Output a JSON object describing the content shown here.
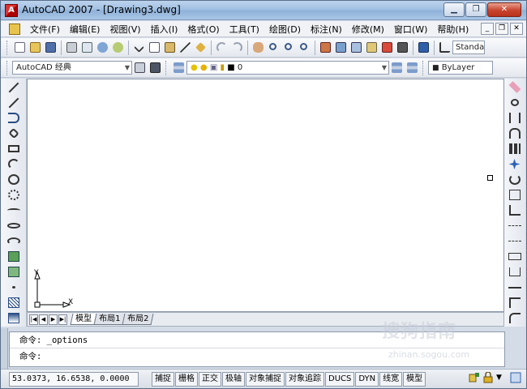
{
  "window": {
    "title": "AutoCAD 2007 - [Drawing3.dwg]",
    "buttons": {
      "minimize": "▁",
      "restore": "❐",
      "close": "✕"
    }
  },
  "menu": {
    "items": [
      "文件(F)",
      "编辑(E)",
      "视图(V)",
      "插入(I)",
      "格式(O)",
      "工具(T)",
      "绘图(D)",
      "标注(N)",
      "修改(M)",
      "窗口(W)",
      "帮助(H)"
    ],
    "mdi_buttons": {
      "minimize": "_",
      "restore": "❐",
      "close": "✕"
    }
  },
  "toolbar_standard": {
    "text_style": "Standa"
  },
  "toolbar_workspace": {
    "workspace": "AutoCAD 经典",
    "layer": "0",
    "linetype": "ByLayer"
  },
  "canvas": {
    "ucs_y": "Y",
    "ucs_x": "X"
  },
  "layout_tabs": [
    "模型",
    "布局1",
    "布局2"
  ],
  "layout_nav": [
    "|◀",
    "◀",
    "▶",
    "▶|"
  ],
  "command": {
    "history": "命令: _options",
    "prompt": "命令:"
  },
  "statusbar": {
    "coordinates": "53.0373, 16.6538, 0.0000",
    "toggles": [
      "捕捉",
      "栅格",
      "正交",
      "极轴",
      "对象捕捉",
      "对象追踪",
      "DUCS",
      "DYN",
      "线宽",
      "模型"
    ]
  },
  "watermark": {
    "text": "搜狗指南",
    "url": "zhinan.sogou.com"
  },
  "colors": {
    "title_gradient": "#9fbfe2",
    "close_button": "#c8432d",
    "canvas": "#ffffff"
  }
}
